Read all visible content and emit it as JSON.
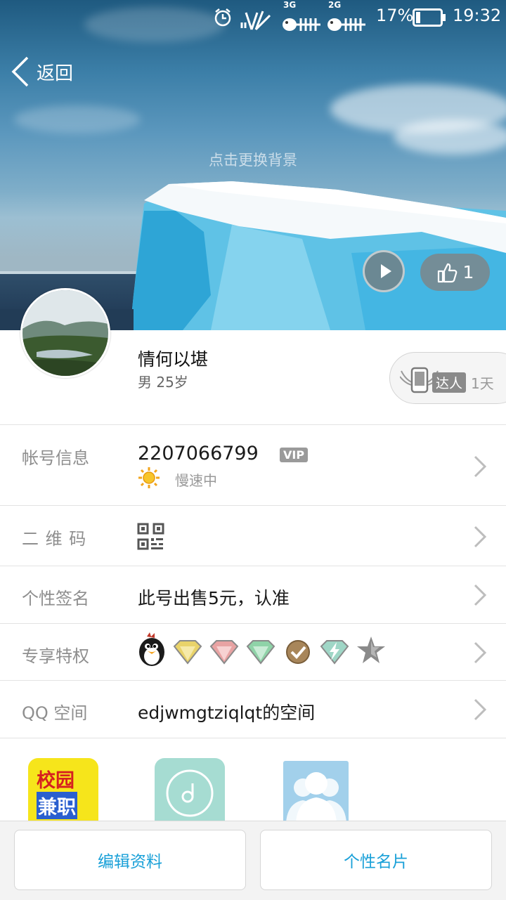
{
  "status_bar": {
    "network_1": "3G",
    "network_2": "2G",
    "battery_percent": "17%",
    "battery_level": 0.17,
    "time": "19:32",
    "icons": [
      "alarm-icon",
      "data-arrows-icon",
      "signal-icon",
      "signal-3g-icon",
      "signal-2g-icon",
      "battery-icon"
    ]
  },
  "header": {
    "back_label": "返回",
    "change_background_hint": "点击更换背景",
    "like_count": "1"
  },
  "profile": {
    "nickname": "情何以堪",
    "gender_age": "男 25岁",
    "talent_badge": "达人",
    "talent_days": "1天"
  },
  "rows": {
    "account": {
      "label": "帐号信息",
      "qq_number": "2207066799",
      "vip_badge": "VIP",
      "status": "慢速中"
    },
    "qrcode": {
      "label": "二 维 码"
    },
    "signature": {
      "label": "个性签名",
      "value": "此号出售5元，认准"
    },
    "privileges": {
      "label": "专享特权",
      "icons": [
        "penguin-icon",
        "gold-diamond-icon",
        "red-diamond-icon",
        "green-diamond-icon",
        "check-medal-icon",
        "lightning-diamond-icon",
        "star-icon"
      ]
    },
    "qzone": {
      "label": "QQ 空间",
      "value": "edjwmgtziqlqt的空间"
    }
  },
  "shortcuts": {
    "campus_line1": "校园",
    "campus_line2": "兼职"
  },
  "bottom_bar": {
    "edit_label": "编辑资料",
    "card_label": "个性名片"
  },
  "colors": {
    "accent": "#19a0d8",
    "label_gray": "#8e8e8e"
  }
}
